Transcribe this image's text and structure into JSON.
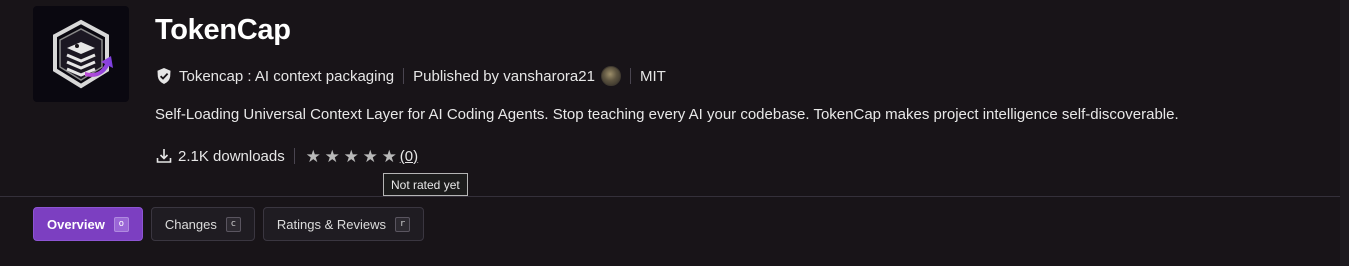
{
  "extension": {
    "name": "TokenCap",
    "publisher_display": "Tokencap : AI context packaging",
    "published_by": "Published by vansharora21",
    "license": "MIT",
    "description": "Self-Loading Universal Context Layer for AI Coding Agents. Stop teaching every AI your codebase. TokenCap makes project intelligence self-discoverable.",
    "downloads": "2.1K downloads",
    "rating": {
      "stars": 5,
      "count_label": "(0)",
      "tooltip": "Not rated yet"
    }
  },
  "icons": {
    "verified": "verified-badge-icon",
    "download": "download-icon",
    "star": "star-icon",
    "logo": "stacked-layers-arrow-logo"
  },
  "tabs": [
    {
      "label": "Overview",
      "key": "o",
      "active": true
    },
    {
      "label": "Changes",
      "key": "c",
      "active": false
    },
    {
      "label": "Ratings & Reviews",
      "key": "r",
      "active": false
    }
  ],
  "colors": {
    "background": "#181418",
    "accent": "#7c3fc1",
    "star": "#b9b9b9"
  }
}
